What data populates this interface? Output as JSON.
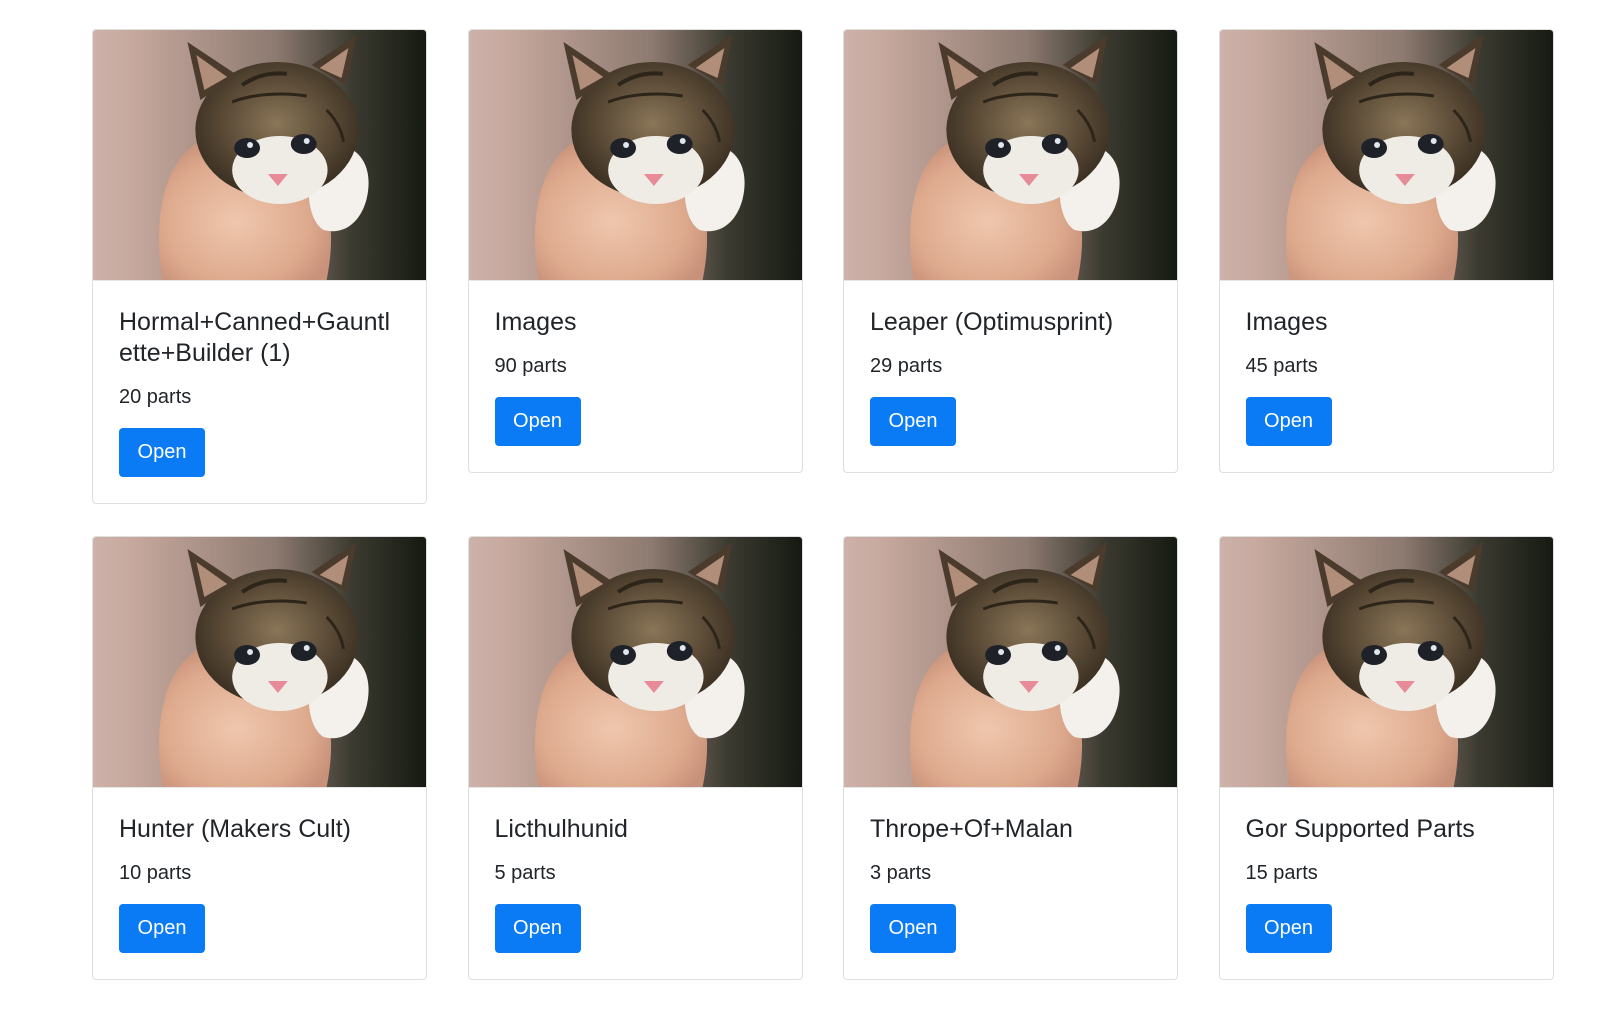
{
  "button_label": "Open",
  "colors": {
    "primary": "#0a7bf5",
    "card_border": "#dfdfdf",
    "text": "#212529"
  },
  "image": {
    "subject": "kitten-photo"
  },
  "cards": [
    {
      "title": "Hormal+Canned+Gauntlette+Builder (1)",
      "parts": "20 parts"
    },
    {
      "title": "Images",
      "parts": "90 parts"
    },
    {
      "title": "Leaper (Optimusprint)",
      "parts": "29 parts"
    },
    {
      "title": "Images",
      "parts": "45 parts"
    },
    {
      "title": "Hunter (Makers Cult)",
      "parts": "10 parts"
    },
    {
      "title": "Licthulhunid",
      "parts": "5 parts"
    },
    {
      "title": "Thrope+Of+Malan",
      "parts": "3 parts"
    },
    {
      "title": "Gor Supported Parts",
      "parts": "15 parts"
    }
  ]
}
